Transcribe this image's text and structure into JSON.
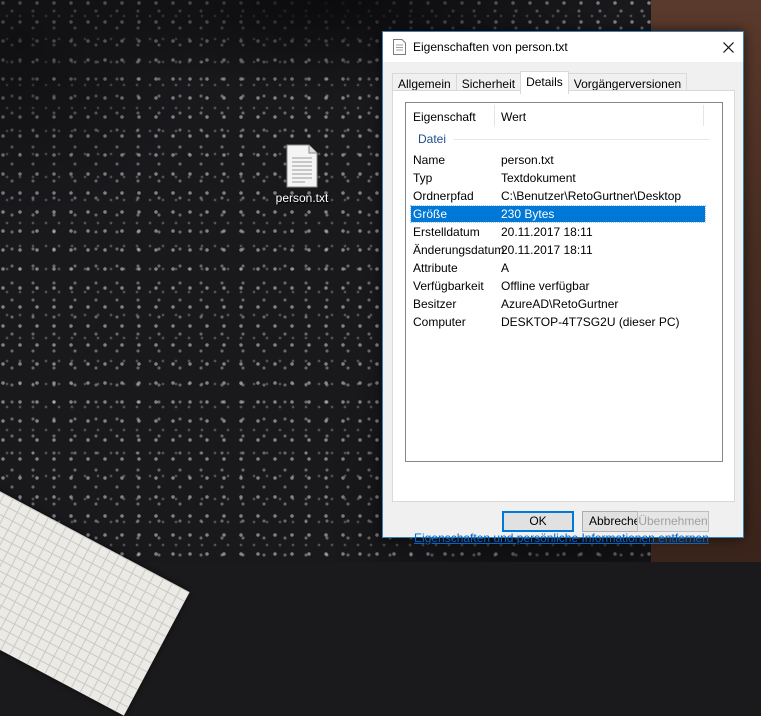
{
  "desktop": {
    "icon_label": "person.txt"
  },
  "dialog": {
    "title": "Eigenschaften von person.txt",
    "tabs": [
      {
        "label": "Allgemein"
      },
      {
        "label": "Sicherheit"
      },
      {
        "label": "Details",
        "active": true
      },
      {
        "label": "Vorgängerversionen"
      }
    ],
    "list": {
      "columns": [
        "Eigenschaft",
        "Wert"
      ],
      "group": "Datei",
      "rows": [
        {
          "key": "Name",
          "value": "person.txt"
        },
        {
          "key": "Typ",
          "value": "Textdokument"
        },
        {
          "key": "Ordnerpfad",
          "value": "C:\\Benutzer\\RetoGurtner\\Desktop"
        },
        {
          "key": "Größe",
          "value": "230 Bytes",
          "selected": true
        },
        {
          "key": "Erstelldatum",
          "value": "20.11.2017 18:11"
        },
        {
          "key": "Änderungsdatum",
          "value": "20.11.2017 18:11"
        },
        {
          "key": "Attribute",
          "value": "A"
        },
        {
          "key": "Verfügbarkeit",
          "value": "Offline verfügbar"
        },
        {
          "key": "Besitzer",
          "value": "AzureAD\\RetoGurtner"
        },
        {
          "key": "Computer",
          "value": "DESKTOP-4T7SG2U (dieser PC)"
        }
      ]
    },
    "remove_link": "Eigenschaften und persönliche Informationen entfernen",
    "buttons": {
      "ok": "OK",
      "cancel": "Abbrechen",
      "apply": "Übernehmen"
    }
  },
  "colors": {
    "selection": "#0078d7",
    "link": "#0066cc",
    "group_header": "#1e4e8c"
  }
}
